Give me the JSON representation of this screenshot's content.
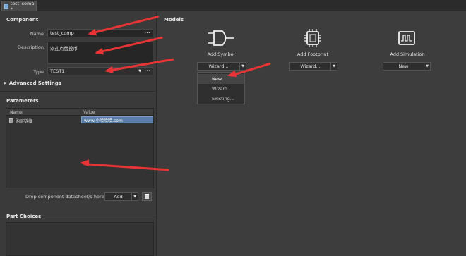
{
  "tab": {
    "title": "test_comp *"
  },
  "component": {
    "section_title": "Component",
    "name_label": "Name",
    "name_value": "test_comp",
    "description_label": "Description",
    "description_value": "欢迎点赞投币",
    "type_label": "Type",
    "type_value": "TEST1",
    "advanced_label": "Advanced Settings",
    "more": "•••"
  },
  "parameters": {
    "section_title": "Parameters",
    "columns": [
      "Name",
      "Value"
    ],
    "rows": [
      {
        "name": "购买链接",
        "value": "www.小哈哈哈.com"
      }
    ],
    "drop_text": "Drop component datasheet/s here or",
    "add_label": "Add"
  },
  "part_choices": {
    "section_title": "Part Choices"
  },
  "models": {
    "section_title": "Models",
    "items": [
      {
        "title": "Add Symbol",
        "button": "Wizard...",
        "icon": "symbol-icon"
      },
      {
        "title": "Add Footprint",
        "button": "Wizard...",
        "icon": "footprint-icon"
      },
      {
        "title": "Add Simulation",
        "button": "New",
        "icon": "simulation-icon"
      }
    ],
    "menu": [
      "New",
      "Wizard...",
      "Existing..."
    ]
  },
  "colors": {
    "arrow": "#e83434",
    "selection": "#5b7fa8",
    "background": "#3c3c3c"
  }
}
